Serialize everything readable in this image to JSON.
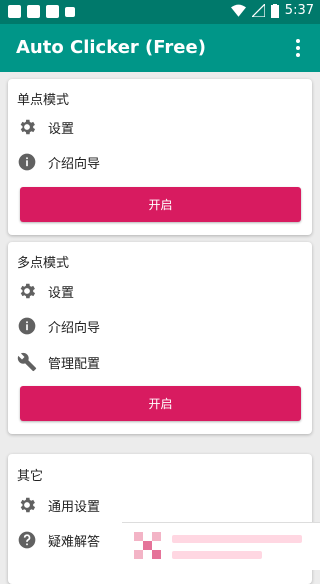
{
  "status": {
    "time": "5:37"
  },
  "app": {
    "title": "Auto Clicker (Free)"
  },
  "cards": [
    {
      "title": "单点模式",
      "items": [
        "设置",
        "介绍向导"
      ],
      "button": "开启"
    },
    {
      "title": "多点模式",
      "items": [
        "设置",
        "介绍向导",
        "管理配置"
      ],
      "button": "开启"
    },
    {
      "title": "其它",
      "items": [
        "通用设置",
        "疑难解答"
      ]
    }
  ],
  "colors": {
    "statusbar": "#00796b",
    "appbar": "#009688",
    "accent": "#d81b60"
  },
  "icons": [
    "gear-icon",
    "info-icon",
    "wrench-icon",
    "help-icon"
  ]
}
